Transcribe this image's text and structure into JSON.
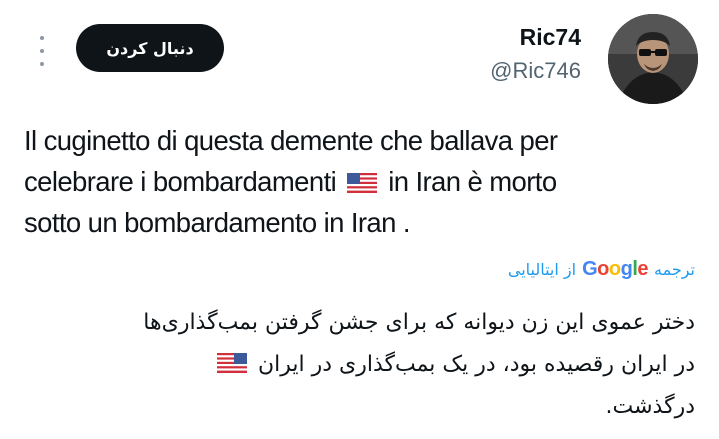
{
  "header": {
    "display_name": "Ric74",
    "handle": "@Ric746",
    "follow_label": "دنبال کردن",
    "more_icon": "more-vertical-icon"
  },
  "tweet": {
    "line1": "Il cuginetto di questa demente che ballava per",
    "line2_a": "celebrare i bombardamenti",
    "line2_b": "in Iran è morto",
    "line3": "sotto un bombardamento in Iran ."
  },
  "translation": {
    "translate_label": "ترجمه",
    "provider": "Google",
    "from_label": "از ایتالیایی",
    "line1": "دختر عموی این زن دیوانه که برای جشن گرفتن بمب‌گذاری‌ها",
    "line2": "در ایران رقصیده بود، در یک بمب‌گذاری در ایران",
    "line3": "درگذشت."
  },
  "colors": {
    "accent": "#1d9bf0",
    "text": "#0f1419",
    "secondary": "#536471"
  }
}
